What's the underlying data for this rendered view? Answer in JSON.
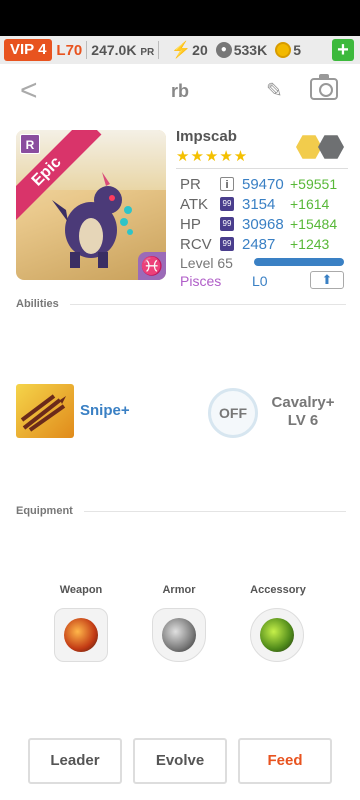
{
  "topbar": {
    "vip": "VIP 4",
    "level": "L70",
    "power": "247.0K",
    "power_unit": "PR",
    "energy": "20",
    "food": "533K",
    "coins": "5",
    "add_label": "+"
  },
  "header": {
    "title": "rb"
  },
  "monster": {
    "rarity": "Epic",
    "rarity_badge": "R",
    "name": "Impscab",
    "stars": "★★★★★",
    "zodiac_symbol": "♓",
    "stats": [
      {
        "label": "PR",
        "chip": "i",
        "value": "59470",
        "bonus": "+59551"
      },
      {
        "label": "ATK",
        "chip": "99",
        "value": "3154",
        "bonus": "+1614"
      },
      {
        "label": "HP",
        "chip": "99",
        "value": "30968",
        "bonus": "+15484"
      },
      {
        "label": "RCV",
        "chip": "99",
        "value": "2487",
        "bonus": "+1243"
      }
    ],
    "level_text": "Level 65",
    "level_progress": 1.0,
    "sign": "Pisces",
    "rank": "L0",
    "upgrade_icon": "up-arrow-icon"
  },
  "abilities": {
    "heading": "Abilities",
    "items": [
      {
        "name": "Snipe+",
        "icon": "arrows-icon"
      },
      {
        "name": "Cavalry+ LV 6",
        "state": "OFF",
        "icon": "cavalry-icon"
      }
    ]
  },
  "equipment": {
    "heading": "Equipment",
    "slots": [
      {
        "label": "Weapon"
      },
      {
        "label": "Armor"
      },
      {
        "label": "Accessory"
      }
    ]
  },
  "actions": {
    "leader": "Leader",
    "evolve": "Evolve",
    "feed": "Feed"
  },
  "colors": {
    "accent_orange": "#e8531f",
    "stat_blue": "#3a80c4",
    "bonus_green": "#58b838",
    "epic_pink": "#d9346a",
    "pisces_purple": "#b05ec8"
  }
}
